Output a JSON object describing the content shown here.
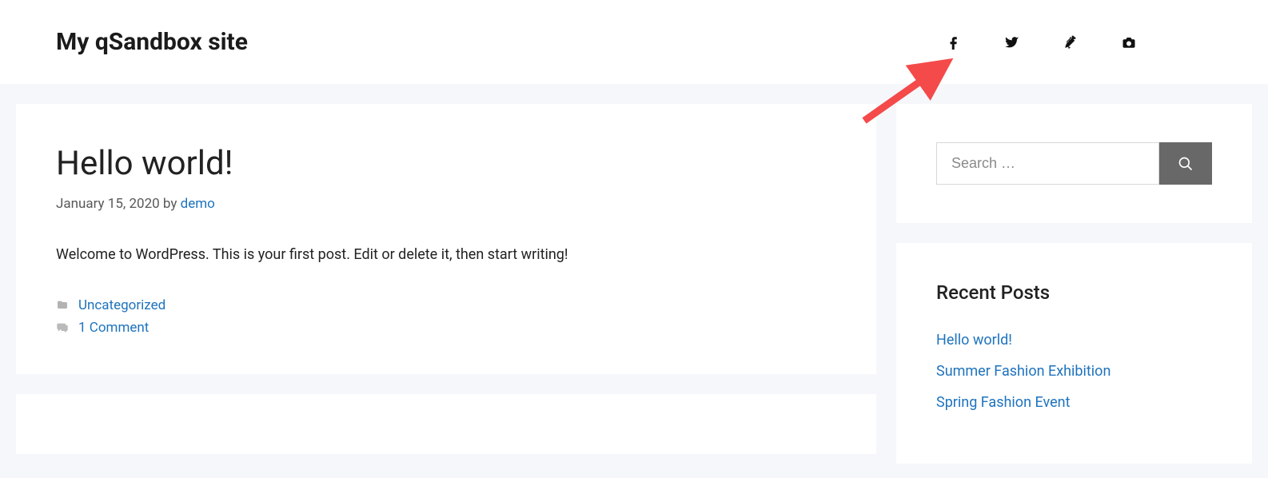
{
  "header": {
    "site_title": "My qSandbox site",
    "social": [
      {
        "name": "facebook-icon"
      },
      {
        "name": "twitter-icon"
      },
      {
        "name": "pinterest-icon"
      },
      {
        "name": "camera-icon"
      }
    ]
  },
  "post": {
    "title": "Hello world!",
    "date": "January 15, 2020",
    "by_label": "by",
    "author": "demo",
    "content": "Welcome to WordPress. This is your first post. Edit or delete it, then start writing!",
    "category": "Uncategorized",
    "comments": "1 Comment"
  },
  "search": {
    "placeholder": "Search …"
  },
  "recent": {
    "title": "Recent Posts",
    "items": [
      "Hello world!",
      "Summer Fashion Exhibition",
      "Spring Fashion Event"
    ]
  }
}
